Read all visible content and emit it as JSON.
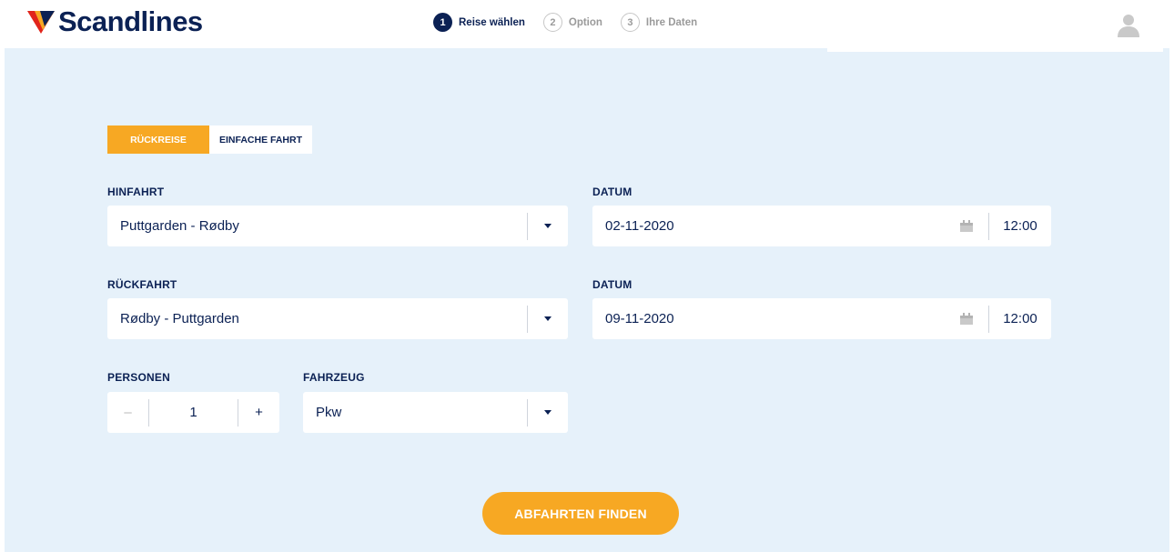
{
  "brand": {
    "name": "Scandlines",
    "colors": {
      "navy": "#0b2154",
      "orange": "#f7a823",
      "red": "#e1251b",
      "panel": "#e6f1fa"
    }
  },
  "steps": [
    {
      "number": "1",
      "label": "Reise wählen",
      "state": "active"
    },
    {
      "number": "2",
      "label": "Option",
      "state": "inactive"
    },
    {
      "number": "3",
      "label": "Ihre Daten",
      "state": "inactive"
    }
  ],
  "header": {
    "user_icon": "user-icon"
  },
  "trip_type": {
    "return_label": "RÜCKREISE",
    "oneway_label": "EINFACHE FAHRT",
    "selected": "RÜCKREISE"
  },
  "outbound": {
    "label": "HINFAHRT",
    "route": "Puttgarden - Rødby",
    "date_label": "DATUM",
    "date": "02-11-2020",
    "time": "12:00"
  },
  "return": {
    "label": "RÜCKFAHRT",
    "route": "Rødby - Puttgarden",
    "date_label": "DATUM",
    "date": "09-11-2020",
    "time": "12:00"
  },
  "passengers": {
    "label": "PERSONEN",
    "minus": "–",
    "count": "1",
    "plus": "+"
  },
  "vehicle": {
    "label": "FAHRZEUG",
    "value": "Pkw"
  },
  "submit": {
    "label": "ABFAHRTEN FINDEN"
  },
  "icons": {
    "dropdown": "chevron-down-icon",
    "calendar": "calendar-icon"
  }
}
